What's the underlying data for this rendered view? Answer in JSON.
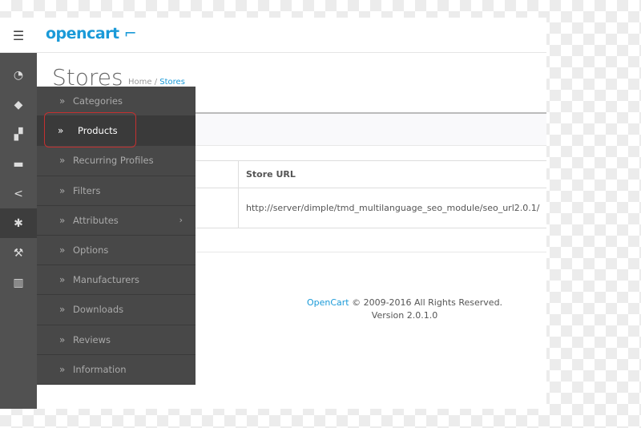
{
  "header": {
    "logo": "opencart ̣̣⌐",
    "toggle_icon": "menu-toggle-icon"
  },
  "sidebar": {
    "icons": [
      "dashboard-icon",
      "tags-icon",
      "puzzle-icon",
      "cart-icon",
      "share-icon",
      "cog-icon",
      "wrench-icon",
      "bar-chart-icon"
    ],
    "active": "cog-icon"
  },
  "page": {
    "title": "Stores",
    "breadcrumb": {
      "home": "Home",
      "sep": "/",
      "current": "Stores"
    }
  },
  "table": {
    "header": {
      "store_url": "Store URL"
    },
    "rows": [
      {
        "store_url": "http://server/dimple/tmd_multilanguage_seo_module/seo_url2.0.1/"
      }
    ]
  },
  "footer": {
    "link": "OpenCart",
    "copyright": " © 2009-2016 All Rights Reserved.",
    "version": "Version 2.0.1.0"
  },
  "menu": {
    "items": [
      {
        "label": "Categories"
      },
      {
        "label": "Products",
        "selected": true
      },
      {
        "label": "Recurring Profiles"
      },
      {
        "label": "Filters"
      },
      {
        "label": "Attributes",
        "submenu": true
      },
      {
        "label": "Options"
      },
      {
        "label": "Manufacturers"
      },
      {
        "label": "Downloads"
      },
      {
        "label": "Reviews"
      },
      {
        "label": "Information"
      }
    ]
  },
  "colors": {
    "accent": "#1a9ad8",
    "sidebar": "#515151",
    "highlight": "#c43030"
  }
}
